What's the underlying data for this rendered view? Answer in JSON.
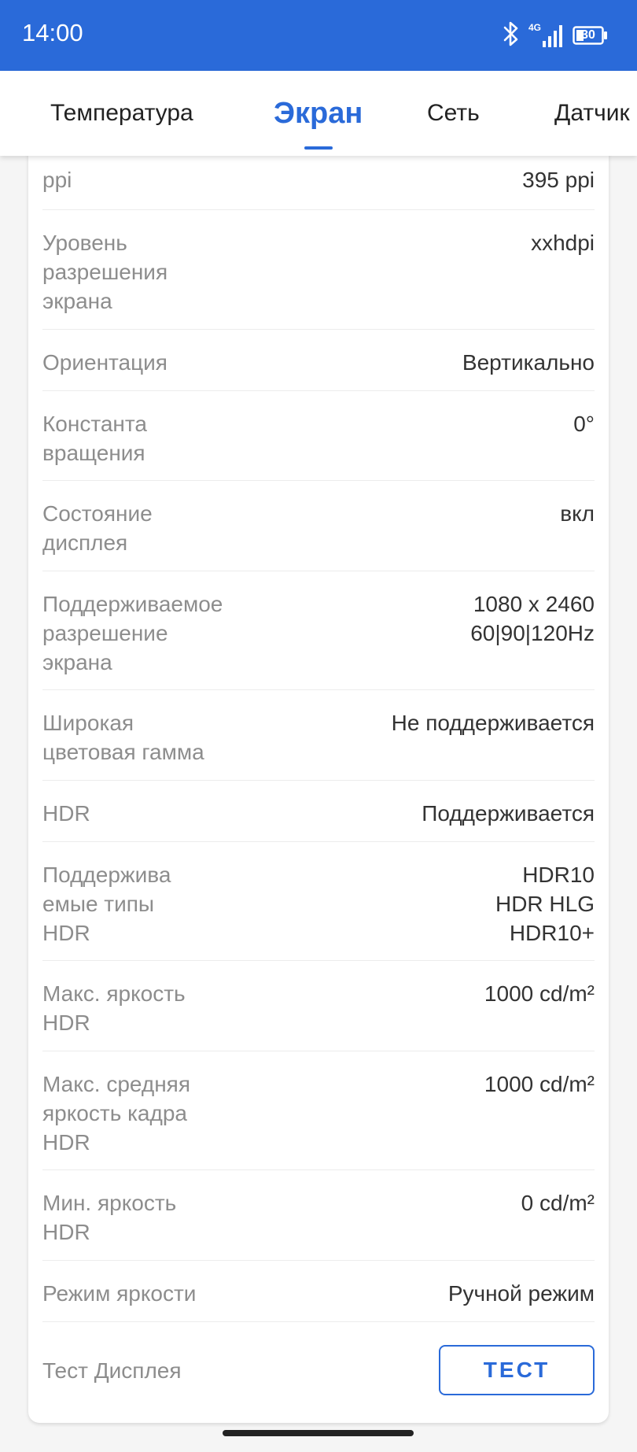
{
  "status_bar": {
    "time": "14:00",
    "network": "4G",
    "battery": "30",
    "icons": [
      "bluetooth-icon",
      "signal-icon",
      "battery-icon"
    ]
  },
  "tabs": [
    {
      "label": "Температура",
      "active": false
    },
    {
      "label": "Экран",
      "active": true
    },
    {
      "label": "Сеть",
      "active": false
    },
    {
      "label": "Датчик",
      "active": false
    }
  ],
  "rows": [
    {
      "label": "ppi",
      "value": "395 ppi"
    },
    {
      "label": "Уровень\nразрешения\nэкрана",
      "value": "xxhdpi"
    },
    {
      "label": "Ориентация",
      "value": "Вертикально"
    },
    {
      "label": "Константа\nвращения",
      "value": "0°"
    },
    {
      "label": "Состояние\nдисплея",
      "value": "вкл"
    },
    {
      "label": "Поддерживаемое\nразрешение\nэкрана",
      "value": "1080 x 2460\n60|90|120Hz"
    },
    {
      "label": "Широкая\nцветовая гамма",
      "value": "Не поддерживается"
    },
    {
      "label": "HDR",
      "value": "Поддерживается"
    },
    {
      "label": "Поддержива\nемые типы\nHDR",
      "value": "HDR10\nHDR HLG\nHDR10+"
    },
    {
      "label": "Макс. яркость\nHDR",
      "value": "1000 cd/m²"
    },
    {
      "label": "Макс. средняя\nяркость кадра\nHDR",
      "value": "1000 cd/m²"
    },
    {
      "label": "Мин. яркость\nHDR",
      "value": "0 cd/m²"
    },
    {
      "label": "Режим яркости",
      "value": "Ручной режим"
    }
  ],
  "display_test": {
    "label": "Тест Дисплея",
    "button_label": "ТЕСТ"
  },
  "colors": {
    "accent": "#2a6ad9",
    "label_text": "#8d8d8d",
    "value_text": "#333333"
  }
}
